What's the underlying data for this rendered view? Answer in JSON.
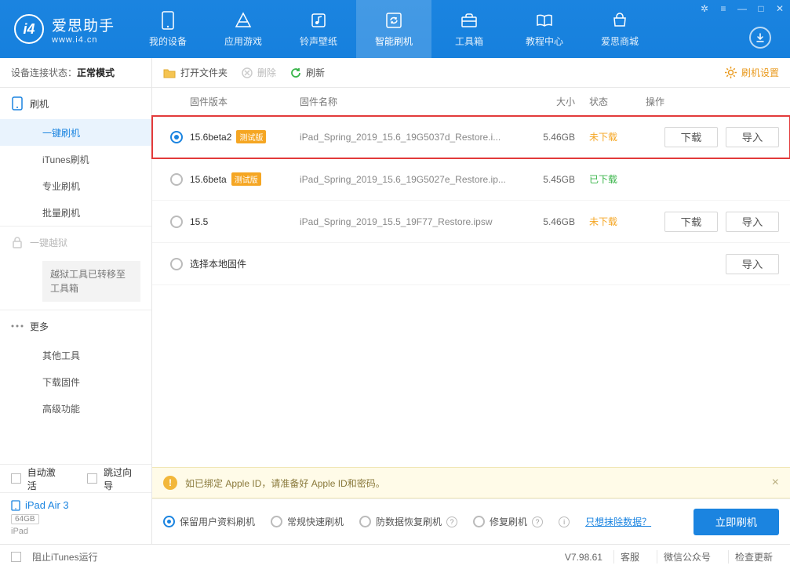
{
  "app": {
    "name_cn": "爱思助手",
    "name_en": "www.i4.cn"
  },
  "topnav": [
    {
      "label": "我的设备"
    },
    {
      "label": "应用游戏"
    },
    {
      "label": "铃声壁纸"
    },
    {
      "label": "智能刷机",
      "active": true
    },
    {
      "label": "工具箱"
    },
    {
      "label": "教程中心"
    },
    {
      "label": "爱思商城"
    }
  ],
  "sidebar": {
    "status_label": "设备连接状态：",
    "status_value": "正常模式",
    "groups": {
      "flash": {
        "title": "刷机",
        "items": [
          "一键刷机",
          "iTunes刷机",
          "专业刷机",
          "批量刷机"
        ]
      },
      "jailbreak": {
        "title": "一键越狱",
        "note": "越狱工具已转移至工具箱"
      },
      "more": {
        "title": "更多",
        "items": [
          "其他工具",
          "下载固件",
          "高级功能"
        ]
      }
    },
    "auto_activate": "自动激活",
    "skip_guide": "跳过向导",
    "device": {
      "name": "iPad Air 3",
      "storage": "64GB",
      "type": "iPad"
    }
  },
  "toolbar": {
    "open": "打开文件夹",
    "delete": "删除",
    "refresh": "刷新",
    "settings": "刷机设置"
  },
  "table": {
    "headers": {
      "version": "固件版本",
      "name": "固件名称",
      "size": "大小",
      "state": "状态",
      "ops": "操作"
    },
    "rows": [
      {
        "version": "15.6beta2",
        "beta": "测试版",
        "name": "iPad_Spring_2019_15.6_19G5037d_Restore.i...",
        "size": "5.46GB",
        "state": "未下载",
        "state_cls": "orange",
        "selected": true,
        "ops": [
          "下载",
          "导入"
        ],
        "highlight": true
      },
      {
        "version": "15.6beta",
        "beta": "测试版",
        "name": "iPad_Spring_2019_15.6_19G5027e_Restore.ip...",
        "size": "5.45GB",
        "state": "已下载",
        "state_cls": "green",
        "selected": false,
        "ops": []
      },
      {
        "version": "15.5",
        "beta": "",
        "name": "iPad_Spring_2019_15.5_19F77_Restore.ipsw",
        "size": "5.46GB",
        "state": "未下载",
        "state_cls": "orange",
        "selected": false,
        "ops": [
          "下载",
          "导入"
        ]
      },
      {
        "version": "",
        "beta": "",
        "name_override": "选择本地固件",
        "size": "",
        "state": "",
        "state_cls": "",
        "selected": false,
        "ops": [
          "导入"
        ]
      }
    ]
  },
  "notice": "如已绑定 Apple ID，请准备好 Apple ID和密码。",
  "flash_options": {
    "opts": [
      {
        "label": "保留用户资料刷机",
        "checked": true
      },
      {
        "label": "常规快速刷机",
        "checked": false
      },
      {
        "label": "防数据恢复刷机",
        "checked": false,
        "help": true
      },
      {
        "label": "修复刷机",
        "checked": false,
        "help": true
      }
    ],
    "erase_link": "只想抹除数据？",
    "flash_now": "立即刷机"
  },
  "footer": {
    "block_itunes": "阻止iTunes运行",
    "version": "V7.98.61",
    "items": [
      "客服",
      "微信公众号",
      "检查更新"
    ]
  }
}
